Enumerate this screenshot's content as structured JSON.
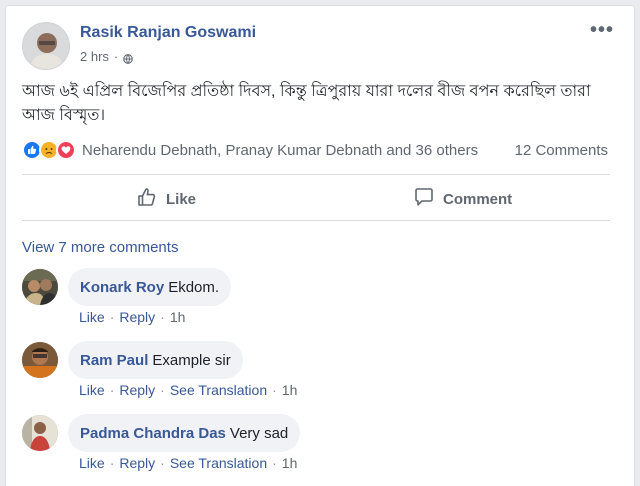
{
  "post": {
    "author": "Rasik Ranjan Goswami",
    "time": "2 hrs",
    "separator": "·",
    "more_label": "•••",
    "text": "আজ ৬ই এপ্রিল বিজেপির প্রতিষ্ঠা দিবস, কিন্তু ত্রিপুরায় যারা দলের বীজ বপন করেছিল তারা আজ বিস্মৃত।",
    "reactions": {
      "icons": [
        "like-reaction-icon",
        "sad-reaction-icon",
        "love-reaction-icon"
      ],
      "names": "Neharendu Debnath, Pranay Kumar Debnath and 36 others",
      "comments": "12 Comments"
    },
    "actions": {
      "like": "Like",
      "comment": "Comment"
    }
  },
  "comments_section": {
    "view_more": "View 7 more comments",
    "comments": [
      {
        "name": "Konark Roy",
        "text": "Ekdom.",
        "like": "Like",
        "reply": "Reply",
        "time": "1h"
      },
      {
        "name": "Ram Paul",
        "text": "Example sir",
        "like": "Like",
        "reply": "Reply",
        "translate": "See Translation",
        "time": "1h"
      },
      {
        "name": "Padma Chandra Das",
        "text": "Very sad",
        "like": "Like",
        "reply": "Reply",
        "translate": "See Translation",
        "time": "1h"
      }
    ]
  },
  "colors": {
    "link_blue": "#385898",
    "muted_text": "#606770",
    "bubble_bg": "#f0f2f5",
    "like_blue": "#1877f2",
    "love_red": "#f33e58",
    "sad_yellow": "#f7b125"
  }
}
